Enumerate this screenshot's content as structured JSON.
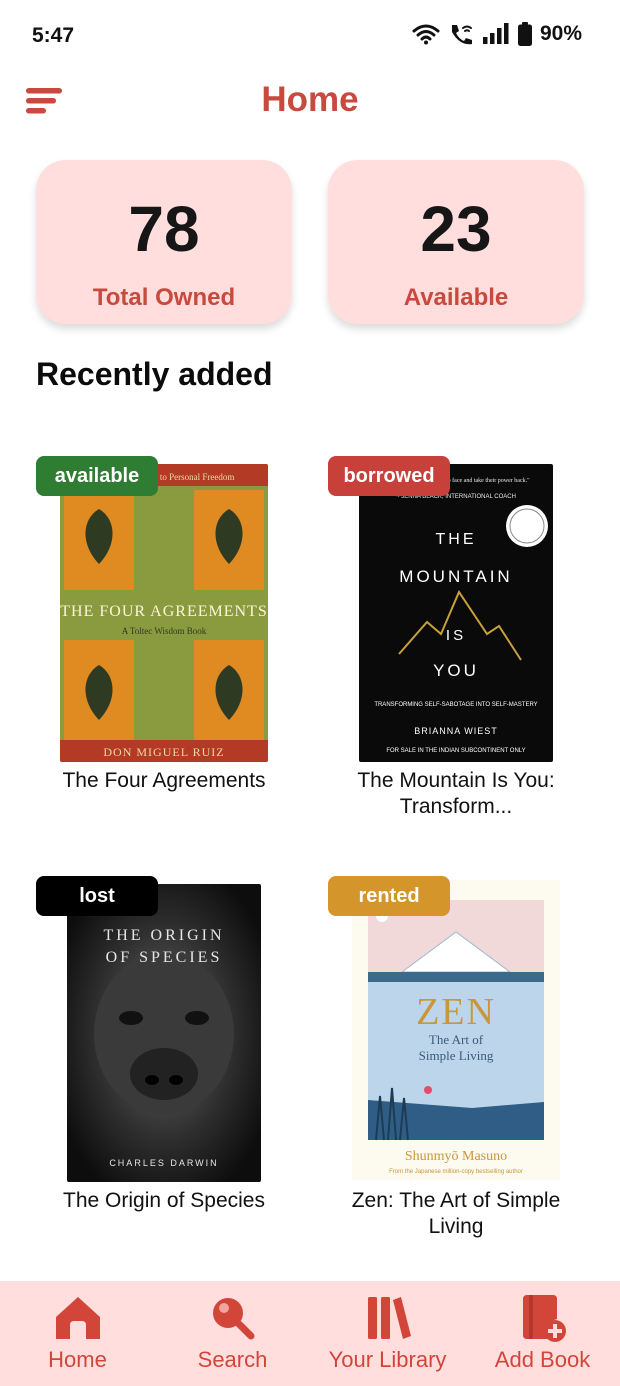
{
  "status_bar": {
    "time": "5:47",
    "battery": "90%",
    "icons": [
      "wifi-icon",
      "wifi-call-icon",
      "signal-icon",
      "battery-icon"
    ]
  },
  "header": {
    "title": "Home",
    "menu_icon": "menu-icon"
  },
  "stats": [
    {
      "value": "78",
      "label": "Total Owned"
    },
    {
      "value": "23",
      "label": "Available"
    }
  ],
  "section": {
    "title": "Recently added"
  },
  "books": [
    {
      "title": "The Four Agreements",
      "status": "available",
      "status_color": "#2e7d32",
      "cover": {
        "top_text": "A Practical Guide to Personal Freedom",
        "title": "THE FOUR AGREEMENTS",
        "subtitle": "A Toltec Wisdom Book",
        "author": "DON MIGUEL RUIZ"
      }
    },
    {
      "title": "The Mountain Is You: Transform...",
      "status": "borrowed",
      "status_color": "#c8403a",
      "cover": {
        "quote": "\"...for those brave enough to face and take their power back.\"",
        "quote_by": "~ JENNA BLACK, INTERNATIONAL COACH",
        "title_line1": "THE",
        "title_line2": "MOUNTAIN",
        "title_line3": "IS",
        "title_line4": "YOU",
        "subtitle": "TRANSFORMING SELF-SABOTAGE INTO SELF-MASTERY",
        "author": "BRIANNA WIEST",
        "footer": "FOR SALE IN THE INDIAN SUBCONTINENT ONLY"
      }
    },
    {
      "title": "The Origin of Species",
      "status": "lost",
      "status_color": "#000000",
      "cover": {
        "title_line1": "THE ORIGIN",
        "title_line2": "OF SPECIES",
        "author": "CHARLES DARWIN"
      }
    },
    {
      "title": "Zen: The Art of Simple Living",
      "status": "rented",
      "status_color": "#d4952a",
      "cover": {
        "title": "ZEN",
        "subtitle_line1": "The Art of",
        "subtitle_line2": "Simple Living",
        "author": "Shunmyō Masuno",
        "footer": "From the Japanese million-copy bestselling author"
      }
    }
  ],
  "bottom_nav": [
    {
      "label": "Home",
      "icon": "home-icon"
    },
    {
      "label": "Search",
      "icon": "search-icon"
    },
    {
      "label": "Your Library",
      "icon": "library-icon"
    },
    {
      "label": "Add Book",
      "icon": "add-book-icon"
    }
  ],
  "colors": {
    "accent": "#c8493d",
    "card_background": "#ffdedd",
    "nav_background": "#ffdedd"
  }
}
